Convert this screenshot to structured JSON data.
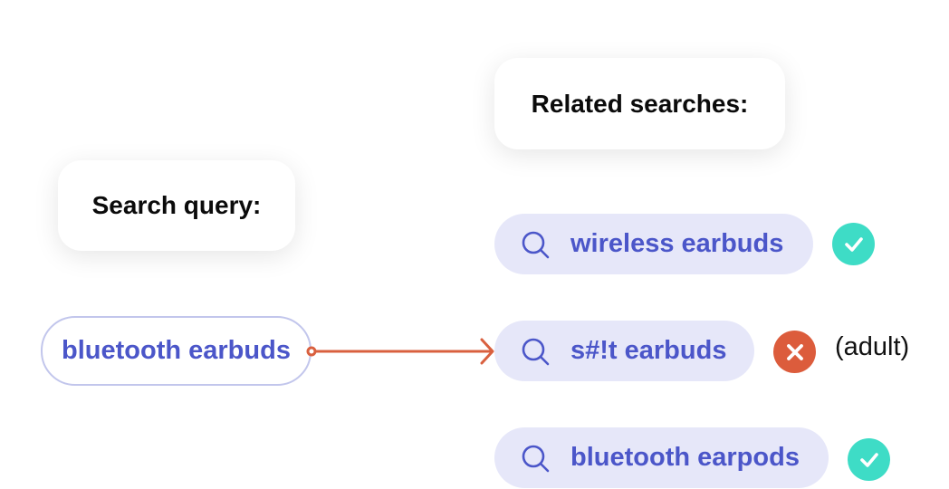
{
  "labels": {
    "search_query": "Search query:",
    "related_searches": "Related searches:"
  },
  "query": {
    "text": "bluetooth earbuds"
  },
  "related": [
    {
      "text": "wireless earbuds",
      "icon": "search-icon",
      "status": "approved",
      "status_icon": "check-icon"
    },
    {
      "text": "s#!t earbuds",
      "icon": "search-icon",
      "status": "rejected",
      "status_icon": "x-icon",
      "note": "(adult)"
    },
    {
      "text": "bluetooth earpods",
      "icon": "search-icon",
      "status": "approved",
      "status_icon": "check-icon"
    }
  ],
  "colors": {
    "accent_text": "#4b56c9",
    "pill_background": "#e6e7f9",
    "query_border": "#c2c6ec",
    "approved": "#3edcc6",
    "rejected": "#dc5c3c",
    "arrow": "#d9603f"
  }
}
